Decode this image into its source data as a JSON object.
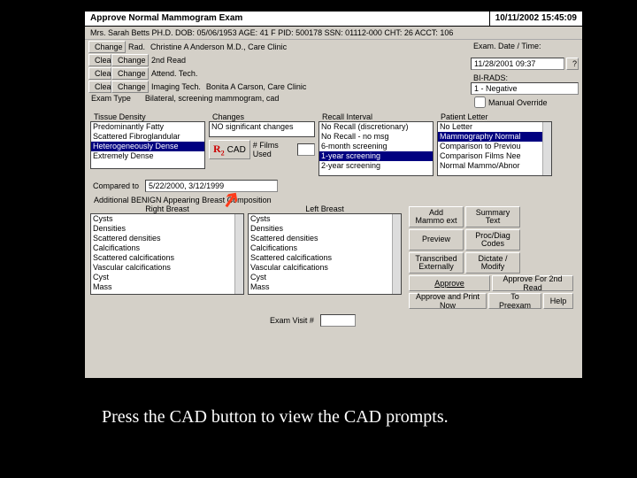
{
  "title": "Approve Normal Mammogram Exam",
  "timestamp": "10/11/2002 15:45:09",
  "patient_line": "Mrs. Sarah Betts PH.D.   DOB: 05/06/1953   AGE: 41   F   PID: 500178   SSN: 01112-000   CHT: 26   ACCT: 106",
  "buttons": {
    "change": "Change",
    "clear": "Clear",
    "cad": "CAD",
    "help": "Help",
    "approve": "Approve",
    "approve_print": "Approve and Print Now",
    "approve_2nd": "Approve For 2nd Read",
    "preexam": "To Preexam",
    "add_mammo": "Add Mammo ext",
    "summary": "Summary Text",
    "preview": "Preview",
    "proc_codes": "Proc/Diag Codes",
    "transcribed": "Transcribed Externally",
    "dictate": "Dictate / Modify"
  },
  "fields": {
    "rad_label": "Rad.",
    "rad_value": "Christine A Anderson M.D., Care Clinic",
    "second_read": "2nd Read",
    "attend_tech": "Attend. Tech.",
    "imaging_tech": "Imaging Tech.",
    "imaging_value": "Bonita A Carson, Care Clinic",
    "exam_type_label": "Exam Type",
    "exam_type_value": "Bilateral, screening mammogram, cad",
    "exam_date_label": "Exam. Date / Time:",
    "exam_date_value": "11/28/2001 09:37",
    "birads_label": "BI-RADS:",
    "birads_value": "1 - Negative",
    "manual_override": "Manual Override",
    "compared_to_label": "Compared to",
    "compared_to_value": "5/22/2000, 3/12/1999",
    "films_used": "# Films Used",
    "exam_visit": "Exam Visit #"
  },
  "sections": {
    "tissue_density": "Tissue Density",
    "changes": "Changes",
    "recall_interval": "Recall Interval",
    "patient_letter": "Patient Letter",
    "additional": "Additional BENIGN Appearing Breast Composition",
    "right_breast": "Right Breast",
    "left_breast": "Left Breast"
  },
  "tissue_density": [
    "Predominantly Fatty",
    "Scattered Fibroglandular",
    "Heterogeneously Dense",
    "Extremely Dense"
  ],
  "tissue_density_sel": 2,
  "changes_list": [
    "NO significant changes"
  ],
  "recall_list": [
    "No Recall (discretionary)",
    "No Recall - no msg",
    "6-month screening",
    "1-year screening",
    "2-year screening"
  ],
  "recall_sel": 3,
  "letter_list": [
    "No Letter",
    "Mammography Normal",
    "Comparison to Previou",
    "Comparison Films Nee",
    "Normal Mammo/Abnor"
  ],
  "letter_sel": 1,
  "breast_list": [
    "Cysts",
    "Densities",
    "Scattered densities",
    "Calcifications",
    "Scattered calcifications",
    "Vascular calcifications",
    "Cyst",
    "Mass"
  ],
  "caption": "Press the CAD button to view the CAD prompts."
}
